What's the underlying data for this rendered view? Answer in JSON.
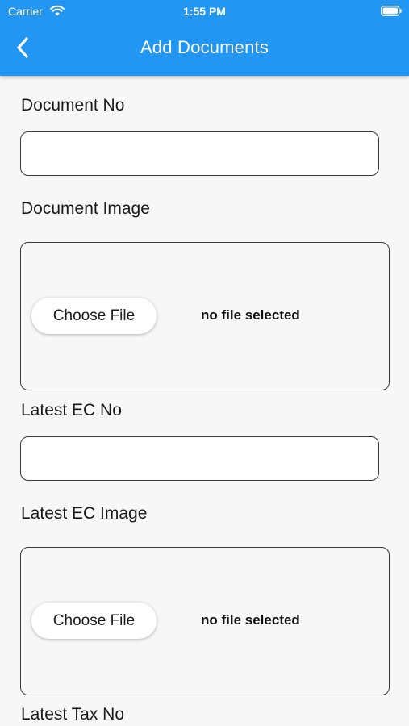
{
  "status_bar": {
    "carrier": "Carrier",
    "time": "1:55 PM",
    "wifi_icon": "wifi-icon",
    "battery_icon": "battery-icon"
  },
  "app_bar": {
    "title": "Add Documents",
    "back_icon": "back-chevron-icon",
    "background_color": "#2196f3"
  },
  "form": {
    "document_no": {
      "label": "Document No",
      "value": ""
    },
    "document_image": {
      "label": "Document Image",
      "button_label": "Choose File",
      "status": "no file selected"
    },
    "latest_ec_no": {
      "label": "Latest EC No",
      "value": ""
    },
    "latest_ec_image": {
      "label": "Latest EC Image",
      "button_label": "Choose File",
      "status": "no file selected"
    },
    "latest_tax_no": {
      "label": "Latest Tax No"
    }
  }
}
